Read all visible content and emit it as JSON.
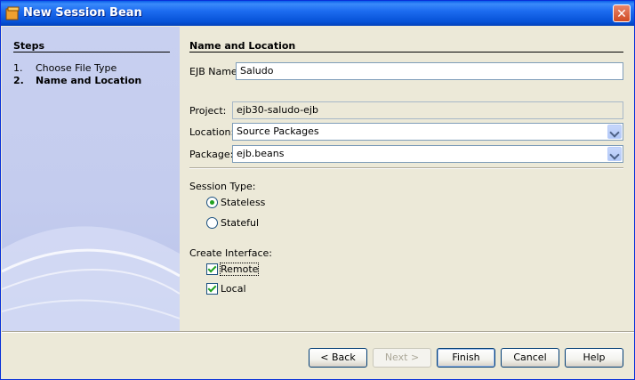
{
  "window": {
    "title": "New Session Bean",
    "close_glyph": "✕"
  },
  "steps": {
    "title": "Steps",
    "items": [
      {
        "num": "1.",
        "label": "Choose File Type",
        "current": false
      },
      {
        "num": "2.",
        "label": "Name and Location",
        "current": true
      }
    ]
  },
  "form": {
    "section_title": "Name and Location",
    "ejb_name_label": "EJB Name:",
    "ejb_name_value": "Saludo",
    "project_label": "Project:",
    "project_value": "ejb30-saludo-ejb",
    "location_label": "Location:",
    "location_value": "Source Packages",
    "package_label": "Package:",
    "package_value": "ejb.beans",
    "session_type_label": "Session Type:",
    "session_type_options": [
      {
        "label": "Stateless",
        "selected": true
      },
      {
        "label": "Stateful",
        "selected": false
      }
    ],
    "create_interface_label": "Create Interface:",
    "interface_options": [
      {
        "label": "Remote",
        "checked": true
      },
      {
        "label": "Local",
        "checked": true
      }
    ]
  },
  "buttons": {
    "back": "< Back",
    "next": "Next >",
    "finish": "Finish",
    "cancel": "Cancel",
    "help": "Help"
  }
}
